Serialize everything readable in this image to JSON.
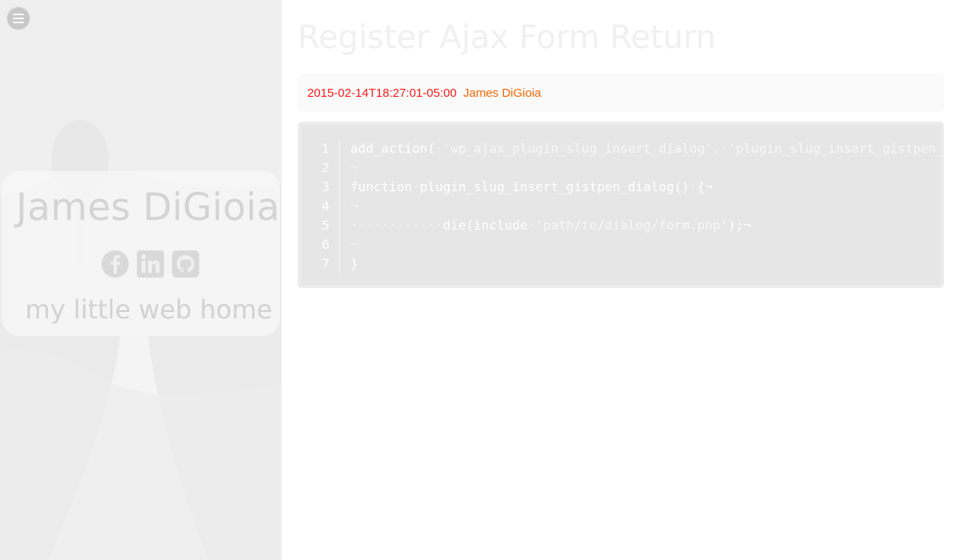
{
  "sidebar": {
    "menu_button_icon": "hamburger-menu-icon",
    "profile": {
      "name": "James DiGioia",
      "tagline": "my little web home",
      "social": [
        {
          "icon": "facebook-icon"
        },
        {
          "icon": "linkedin-icon"
        },
        {
          "icon": "github-icon"
        }
      ]
    }
  },
  "post": {
    "title": "Register Ajax Form Return",
    "meta": {
      "date": "2015-02-14T18:27:01-05:00",
      "author": "James DiGioia"
    },
    "code": {
      "line_numbers": [
        "1",
        "2",
        "3",
        "4",
        "5",
        "6",
        "7"
      ],
      "lines": [
        [
          "add_action(",
          "·",
          "'wp_ajax_plugin_slug_insert_dialog'",
          ",·",
          "'plugin_slug_insert_gistpen_"
        ],
        [
          "¬"
        ],
        [
          "function",
          "·",
          "plugin_slug_insert_gistpen_dialog()",
          "·",
          "{¬"
        ],
        [
          "¬"
        ],
        [
          "············",
          "die(include",
          "·",
          "'path/to/dialog/form.php'",
          ");¬"
        ],
        [
          "¬"
        ],
        [
          "}"
        ]
      ]
    }
  },
  "colors": {
    "meta_date": "#ff1a1a",
    "meta_author": "#ff6600",
    "code_bg": "#e6e6e6"
  }
}
